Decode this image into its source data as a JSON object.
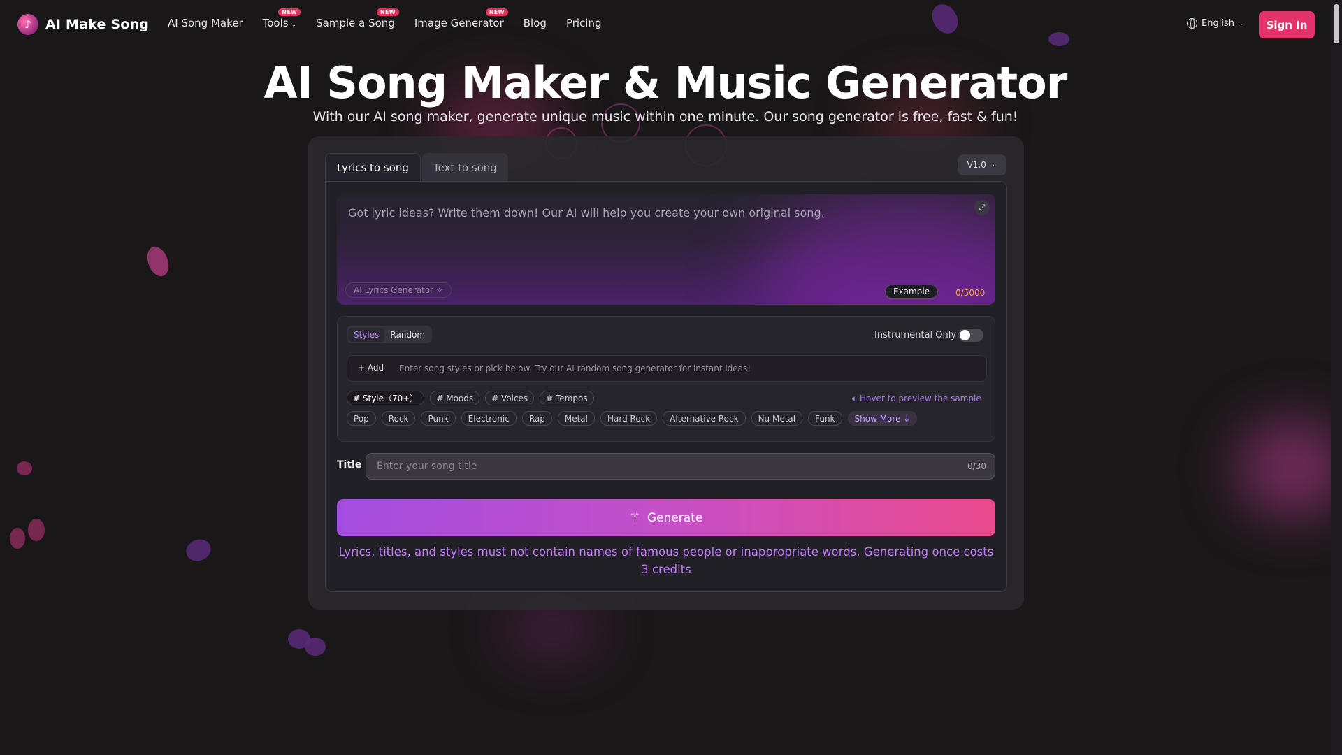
{
  "app": {
    "name": "AI Make Song"
  },
  "nav": {
    "links": [
      {
        "label": "AI Song Maker",
        "badge": ""
      },
      {
        "label": "Tools",
        "badge": "NEW"
      },
      {
        "label": "Sample a Song",
        "badge": "NEW"
      },
      {
        "label": "Image Generator",
        "badge": "NEW"
      },
      {
        "label": "Blog",
        "badge": ""
      },
      {
        "label": "Pricing",
        "badge": ""
      }
    ],
    "language": "English",
    "signin": "Sign In"
  },
  "hero": {
    "title": "AI Song Maker & Music Generator",
    "subtitle": "With our AI song maker, generate unique music within one minute. Our song generator is free, fast & fun!"
  },
  "tabs": {
    "active": "Lyrics to song",
    "inactive": "Text to song"
  },
  "version": "V1.0",
  "lyrics": {
    "placeholder": "Got lyric ideas? Write them down! Our AI will help you create your own original song.",
    "generator_label": "AI Lyrics Generator",
    "example_label": "Example",
    "counter": "0/5000"
  },
  "styles": {
    "seg_styles": "Styles",
    "seg_random": "Random",
    "instrumental_label": "Instrumental Only",
    "add_label": "+ Add",
    "add_placeholder": "Enter song styles or pick below. Try our AI random song generator for instant ideas!",
    "filters": [
      "# Style（70+）",
      "# Moods",
      "# Voices",
      "# Tempos"
    ],
    "hover_hint": "Hover to preview the sample",
    "tags": [
      "Pop",
      "Rock",
      "Punk",
      "Electronic",
      "Rap",
      "Metal",
      "Hard Rock",
      "Alternative Rock",
      "Nu Metal",
      "Funk"
    ],
    "show_more": "Show More ↓"
  },
  "title_field": {
    "label": "Title",
    "placeholder": "Enter your song title",
    "counter": "0/30"
  },
  "generate": {
    "label": "Generate"
  },
  "notice": "Lyrics, titles, and styles must not contain names of famous people or inappropriate words. Generating once costs 3 credits",
  "colors": {
    "accent": "#e2336b",
    "purple": "#a44ee0",
    "counter": "#f0a23a"
  }
}
